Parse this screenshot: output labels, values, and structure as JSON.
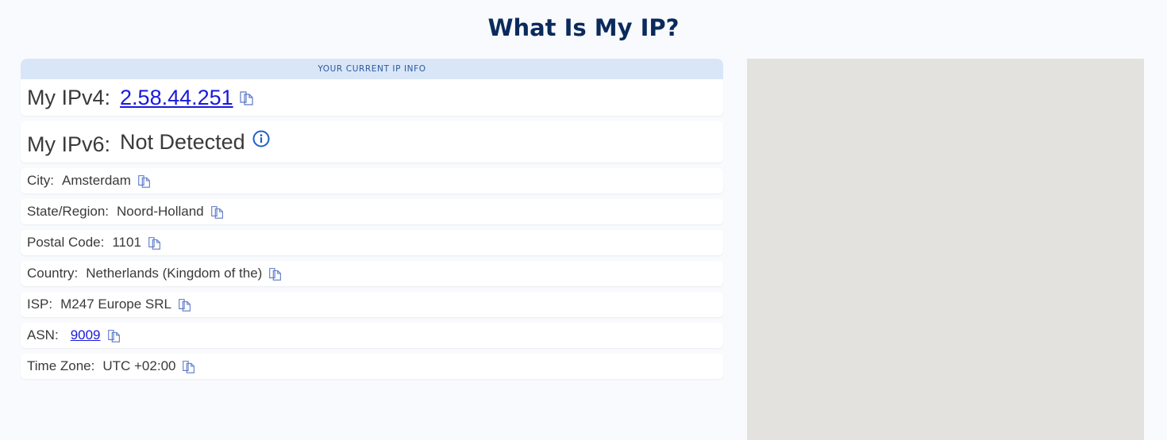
{
  "page": {
    "title": "What Is My IP?"
  },
  "info": {
    "header": "YOUR CURRENT IP INFO",
    "ipv4": {
      "label": "My IPv4:",
      "value": "2.58.44.251"
    },
    "ipv6": {
      "label": "My IPv6:",
      "value": "Not Detected"
    },
    "city": {
      "label": "City:",
      "value": "Amsterdam"
    },
    "region": {
      "label": "State/Region:",
      "value": "Noord-Holland"
    },
    "postal": {
      "label": "Postal Code:",
      "value": "1101"
    },
    "country": {
      "label": "Country:",
      "value": "Netherlands (Kingdom of the)"
    },
    "isp": {
      "label": "ISP:",
      "value": "M247 Europe SRL"
    },
    "asn": {
      "label": "ASN:",
      "value": "9009"
    },
    "timezone": {
      "label": "Time Zone:",
      "value": "UTC +02:00"
    }
  },
  "icons": {
    "copy": "copy-icon",
    "info": "info-icon"
  },
  "colors": {
    "title": "#0b2a5c",
    "header_band": "#d9e6f8",
    "link": "#1a1adc",
    "icon": "#5a78c8",
    "info_icon": "#1f5fc8",
    "map_placeholder": "#e3e2de"
  }
}
